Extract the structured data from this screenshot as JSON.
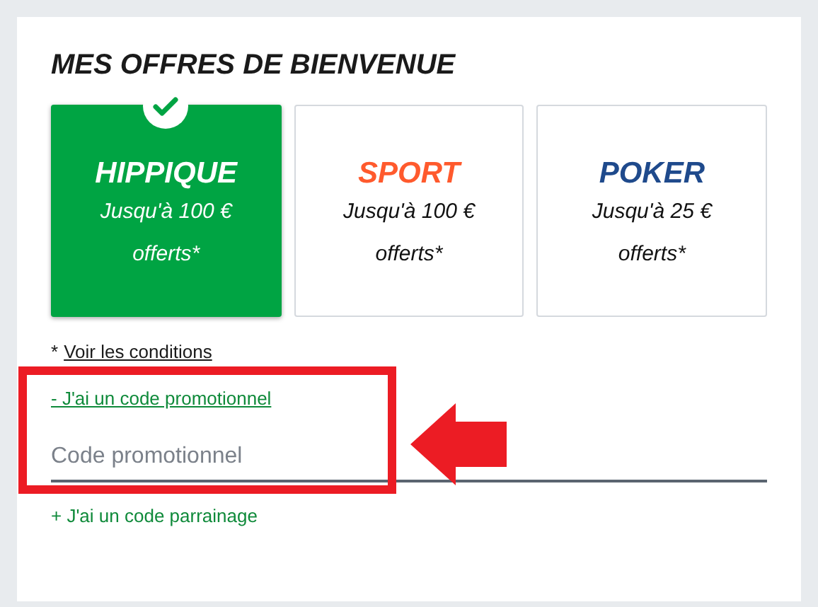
{
  "title": "MES OFFRES DE BIENVENUE",
  "offers": [
    {
      "name": "HIPPIQUE",
      "description": "Jusqu'à 100 € offerts*",
      "color": "#00a443",
      "selected": true
    },
    {
      "name": "SPORT",
      "description": "Jusqu'à 100 € offerts*",
      "color": "#ff5a2d",
      "selected": false
    },
    {
      "name": "POKER",
      "description": "Jusqu'à 25 € offerts*",
      "color": "#1f4a8c",
      "selected": false
    }
  ],
  "conditions": {
    "prefix": "*",
    "link": "Voir les conditions"
  },
  "promo": {
    "toggle": "- J'ai un code promotionnel",
    "expanded": true,
    "field": {
      "placeholder": "Code promotionnel"
    }
  },
  "referral": {
    "toggle": "+ J'ai un code parrainage",
    "expanded": false
  }
}
